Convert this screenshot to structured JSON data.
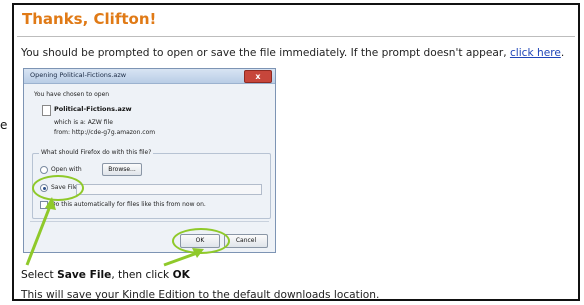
{
  "margin_char": "e",
  "header": {
    "title": "Thanks, Clifton!"
  },
  "prompt": {
    "text": "You should be prompted to open or save the file immediately. If the prompt doesn't appear, ",
    "link": "click here",
    "end": "."
  },
  "dialog": {
    "title": "Opening Political-Fictions.azw",
    "close_label": "x",
    "chosen_text": "You have chosen to open",
    "filename": "Political-Fictions.azw",
    "which_is": "which is a:  AZW file",
    "from": "from:  http://cde-g7g.amazon.com",
    "question": "What should Firefox do with this file?",
    "open_with_label": "Open with",
    "browse_label": "Browse...",
    "save_file_label": "Save File",
    "auto_label": "Do this automatically for files like this from now on.",
    "ok_label": "OK",
    "cancel_label": "Cancel"
  },
  "annotation_color": "#8fc92a",
  "instruction": {
    "pre": "Select ",
    "bold1": "Save File",
    "mid": ", then click ",
    "bold2": "OK"
  },
  "footer": {
    "text": "This will save your Kindle Edition to the default downloads location."
  }
}
